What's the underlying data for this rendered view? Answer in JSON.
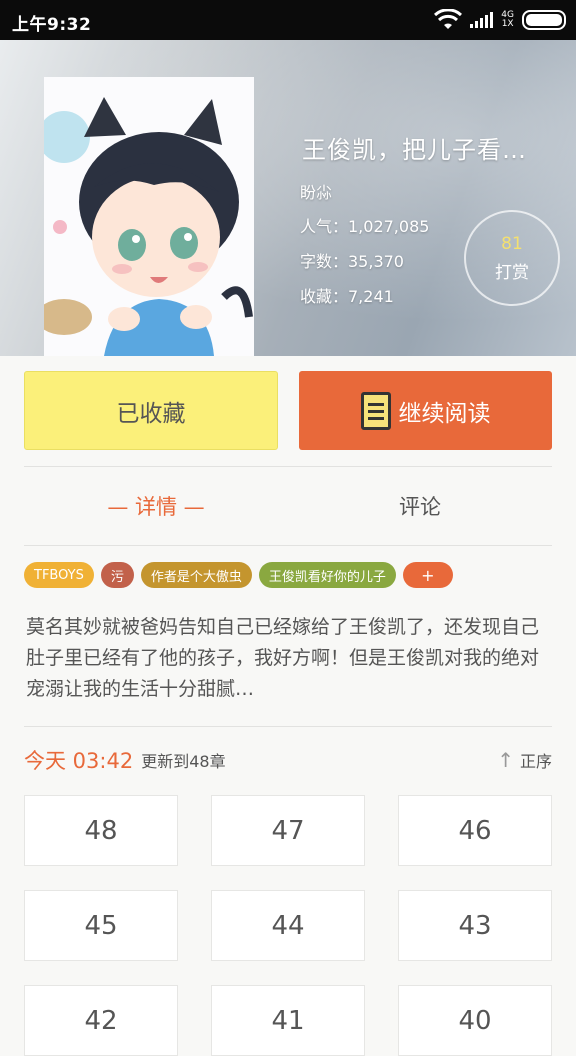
{
  "status": {
    "time": "上午9:32",
    "network_top": "4G",
    "network_bottom": "1X"
  },
  "book": {
    "title": "王俊凯，把儿子看…",
    "author": "盼尛",
    "popularity": "人气：1,027,085",
    "word_count": "字数：35,370",
    "favorites": "收藏：7,241",
    "reward_count": "81",
    "reward_label": "打赏"
  },
  "actions": {
    "collected_label": "已收藏",
    "continue_label": "继续阅读"
  },
  "tabs": [
    {
      "label": "— 详情 —"
    },
    {
      "label": "评论"
    }
  ],
  "tags": [
    "TFBOYS",
    "污",
    "作者是个大傲虫",
    "王俊凯看好你的儿子",
    "+"
  ],
  "summary": "莫名其妙就被爸妈告知自己已经嫁给了王俊凯了，还发现自己肚子里已经有了他的孩子，我好方啊！但是王俊凯对我的绝对宠溺让我的生活十分甜腻…",
  "update": {
    "time": "今天 03:42",
    "text": "更新到48章",
    "sort_label": "正序"
  },
  "chapters": [
    "48",
    "47",
    "46",
    "45",
    "44",
    "43",
    "42",
    "41",
    "40"
  ],
  "colors": {
    "accent": "#e8693a",
    "collected_bg": "#fbf07a"
  },
  "icons": {
    "status": [
      "wifi-icon",
      "signal-icon",
      "battery-icon"
    ],
    "read_button": "book-icon",
    "sort": "arrow-up-icon"
  }
}
